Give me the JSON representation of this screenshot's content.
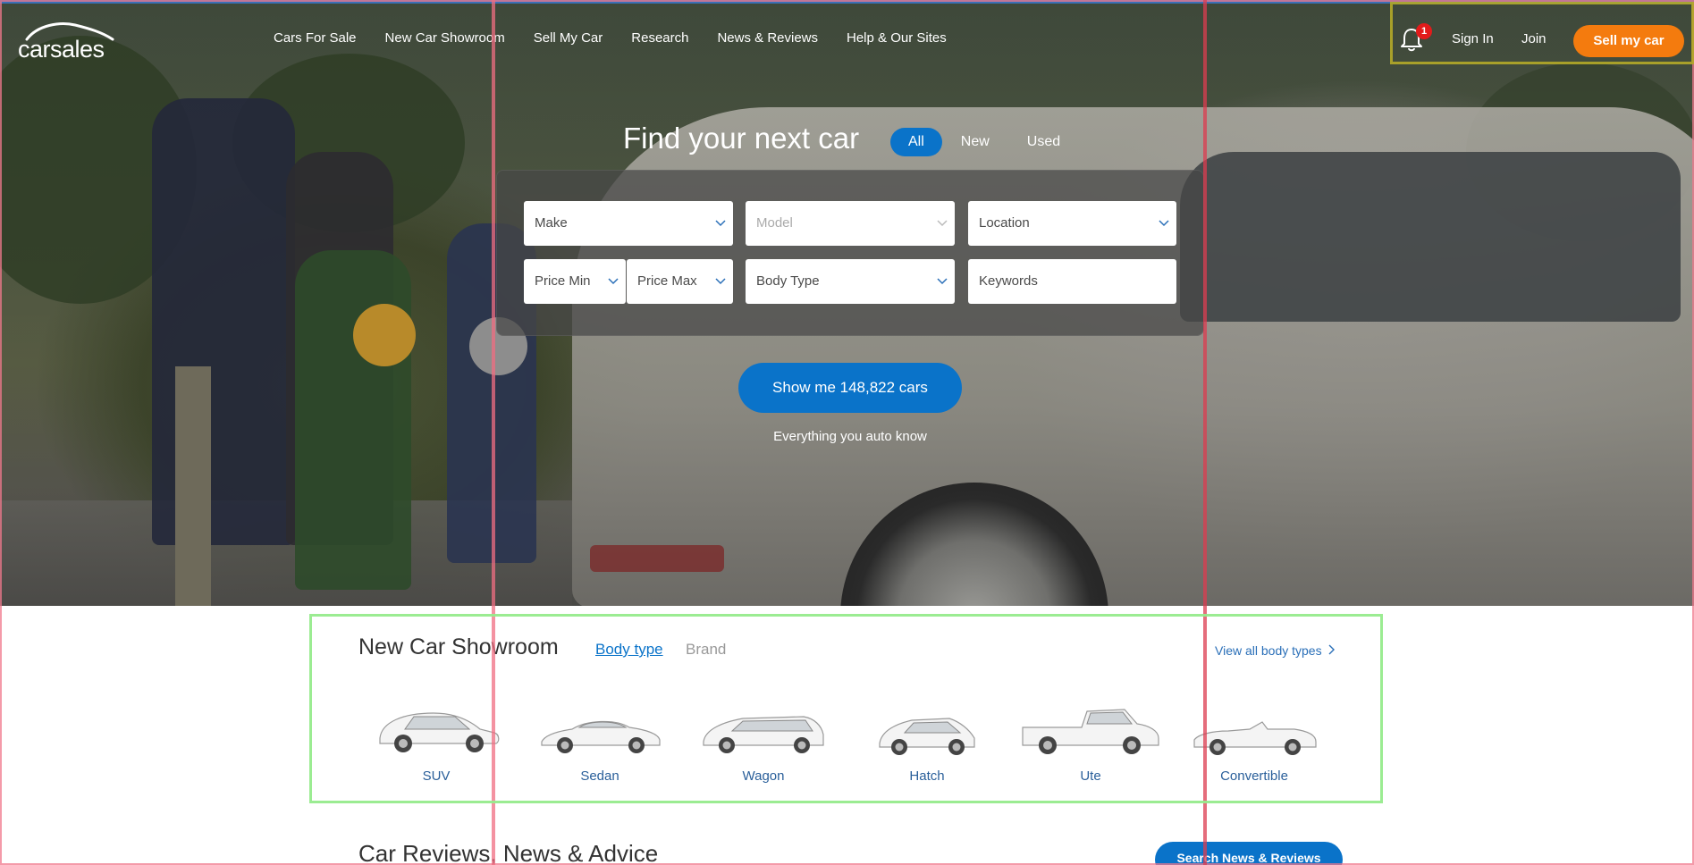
{
  "header": {
    "logo_text": "carsales",
    "nav": [
      "Cars For Sale",
      "New Car Showroom",
      "Sell My Car",
      "Research",
      "News & Reviews",
      "Help & Our Sites"
    ],
    "notification_count": "1",
    "sign_in": "Sign In",
    "join": "Join",
    "sell_button": "Sell my car"
  },
  "search": {
    "title": "Find your next car",
    "segments": [
      "All",
      "New",
      "Used"
    ],
    "active_segment": "All",
    "fields": {
      "make": "Make",
      "model": "Model",
      "location": "Location",
      "price_min": "Price Min",
      "price_max": "Price Max",
      "body_type": "Body Type",
      "keywords": "Keywords"
    },
    "show_button": "Show me 148,822 cars",
    "tagline": "Everything you auto know"
  },
  "showroom": {
    "title": "New Car Showroom",
    "tabs": [
      "Body type",
      "Brand"
    ],
    "active_tab": "Body type",
    "view_all": "View all body types",
    "body_types": [
      "SUV",
      "Sedan",
      "Wagon",
      "Hatch",
      "Ute",
      "Convertible"
    ]
  },
  "reviews": {
    "title": "Car Reviews, News & Advice",
    "search_button": "Search News & Reviews"
  },
  "colors": {
    "primary_blue": "#0a73c9",
    "sell_orange": "#f47b0e",
    "badge_red": "#e21b1b"
  }
}
